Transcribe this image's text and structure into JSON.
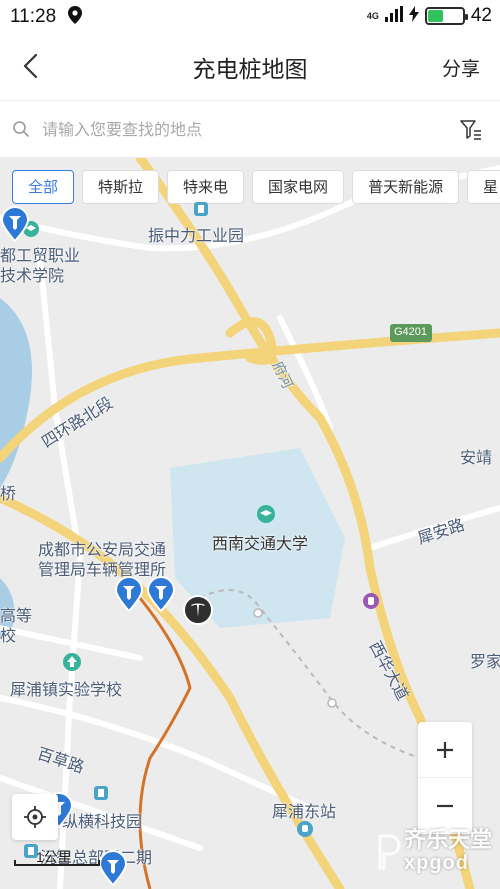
{
  "status_bar": {
    "time": "11:28",
    "network": "4G",
    "battery_level": "42",
    "battery_fraction": 0.42
  },
  "header": {
    "title": "充电桩地图",
    "share_label": "分享"
  },
  "search": {
    "placeholder": "请输入您要查找的地点",
    "value": ""
  },
  "filters": [
    {
      "label": "全部",
      "active": true
    },
    {
      "label": "特斯拉",
      "active": false
    },
    {
      "label": "特来电",
      "active": false
    },
    {
      "label": "国家电网",
      "active": false
    },
    {
      "label": "普天新能源",
      "active": false
    },
    {
      "label": "星",
      "active": false
    }
  ],
  "map": {
    "labels": {
      "zhenzhongli": "振中力工业园",
      "college_line1": "都工贸职业",
      "college_line2": "技术学院",
      "ring_road": "四环路北段",
      "highway_shield": "G4201",
      "fuhe": "府河",
      "anjing": "安靖",
      "qiao": "桥",
      "swjtu": "西南交通大学",
      "xian_road": "犀安路",
      "police_line1": "成都市公安局交通",
      "police_line2": "管理局车辆管理所",
      "gaodeng_line1": "高等",
      "gaodeng_line2": "校",
      "xihua_ave": "西华大道",
      "luojia": "罗家",
      "school": "犀浦镇实验学校",
      "baicao": "百草路",
      "hengtech": "纵横科技园",
      "station": "犀浦东站",
      "phase2": "沅智总部园二期"
    },
    "colors": {
      "water": "#a9cde4",
      "campus": "#cfe5ef",
      "major_road": "#f3d47a",
      "minor_road": "#ffffff",
      "metro_line": "#d47328",
      "marker_blue": "#2e79d6",
      "marker_dark": "#2f2f2f"
    },
    "scale_label": "1公里"
  },
  "watermark": {
    "text": "齐乐天堂",
    "sub": "xpgod"
  }
}
